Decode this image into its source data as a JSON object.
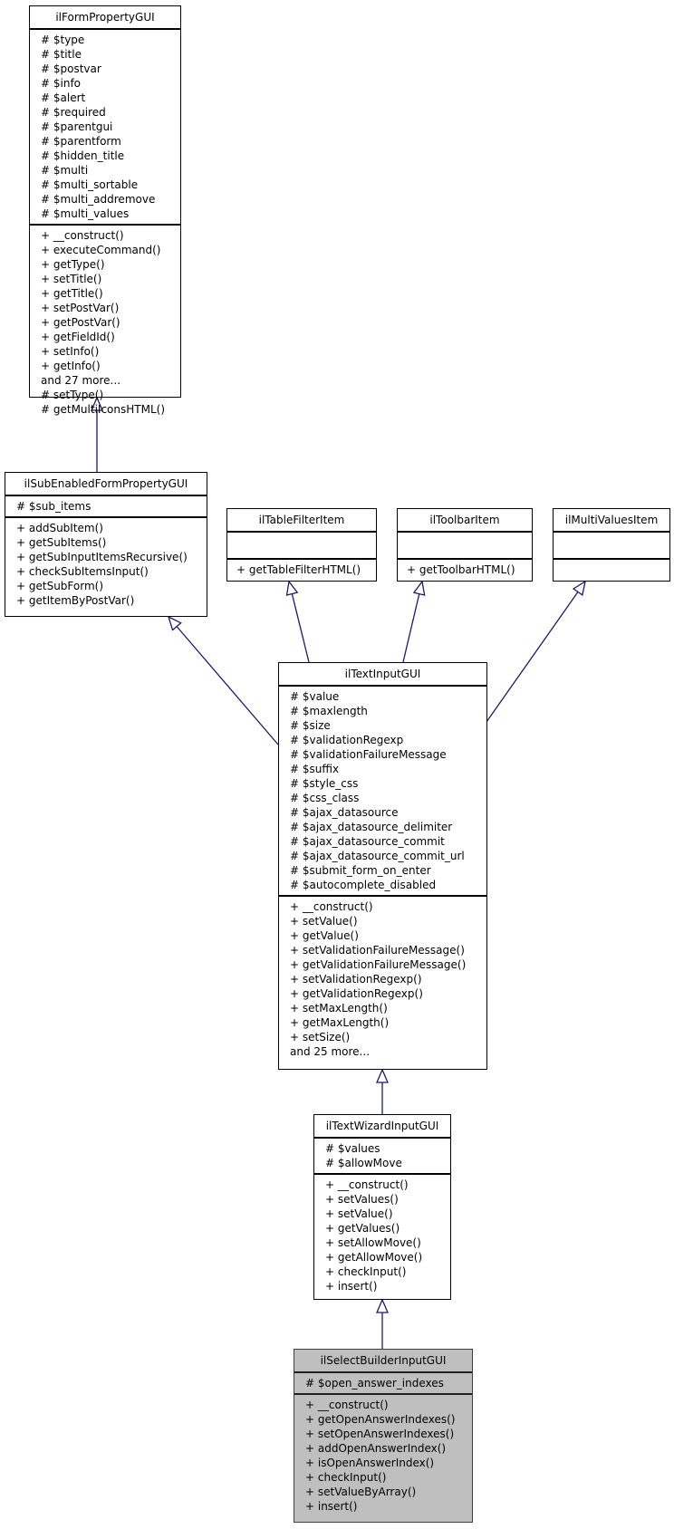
{
  "classes": {
    "ilFormPropertyGUI": {
      "name": "ilFormPropertyGUI",
      "attributes": [
        "# $type",
        "# $title",
        "# $postvar",
        "# $info",
        "# $alert",
        "# $required",
        "# $parentgui",
        "# $parentform",
        "# $hidden_title",
        "# $multi",
        "# $multi_sortable",
        "# $multi_addremove",
        "# $multi_values"
      ],
      "methods": [
        "+ __construct()",
        "+ executeCommand()",
        "+ getType()",
        "+ setTitle()",
        "+ getTitle()",
        "+ setPostVar()",
        "+ getPostVar()",
        "+ getFieldId()",
        "+ setInfo()",
        "+ getInfo()",
        "and 27 more...",
        "# setType()",
        "# getMultiIconsHTML()"
      ]
    },
    "ilSubEnabledFormPropertyGUI": {
      "name": "ilSubEnabledFormPropertyGUI",
      "attributes": [
        "# $sub_items"
      ],
      "methods": [
        "+ addSubItem()",
        "+ getSubItems()",
        "+ getSubInputItemsRecursive()",
        "+ checkSubItemsInput()",
        "+ getSubForm()",
        "+ getItemByPostVar()"
      ]
    },
    "ilTableFilterItem": {
      "name": "ilTableFilterItem",
      "attributes": [],
      "methods": [
        "+ getTableFilterHTML()"
      ]
    },
    "ilToolbarItem": {
      "name": "ilToolbarItem",
      "attributes": [],
      "methods": [
        "+ getToolbarHTML()"
      ]
    },
    "ilMultiValuesItem": {
      "name": "ilMultiValuesItem",
      "attributes": [],
      "methods": []
    },
    "ilTextInputGUI": {
      "name": "ilTextInputGUI",
      "attributes": [
        "# $value",
        "# $maxlength",
        "# $size",
        "# $validationRegexp",
        "# $validationFailureMessage",
        "# $suffix",
        "# $style_css",
        "# $css_class",
        "# $ajax_datasource",
        "# $ajax_datasource_delimiter",
        "# $ajax_datasource_commit",
        "# $ajax_datasource_commit_url",
        "# $submit_form_on_enter",
        "# $autocomplete_disabled"
      ],
      "methods": [
        "+ __construct()",
        "+ setValue()",
        "+ getValue()",
        "+ setValidationFailureMessage()",
        "+ getValidationFailureMessage()",
        "+ setValidationRegexp()",
        "+ getValidationRegexp()",
        "+ setMaxLength()",
        "+ getMaxLength()",
        "+ setSize()",
        "and 25 more..."
      ]
    },
    "ilTextWizardInputGUI": {
      "name": "ilTextWizardInputGUI",
      "attributes": [
        "# $values",
        "# $allowMove"
      ],
      "methods": [
        "+ __construct()",
        "+ setValues()",
        "+ setValue()",
        "+ getValues()",
        "+ setAllowMove()",
        "+ getAllowMove()",
        "+ checkInput()",
        "+ insert()"
      ]
    },
    "ilSelectBuilderInputGUI": {
      "name": "ilSelectBuilderInputGUI",
      "attributes": [
        "# $open_answer_indexes"
      ],
      "methods": [
        "+ __construct()",
        "+ getOpenAnswerIndexes()",
        "+ setOpenAnswerIndexes()",
        "+ addOpenAnswerIndex()",
        "+ isOpenAnswerIndex()",
        "+ checkInput()",
        "+ setValueByArray()",
        "+ insert()"
      ]
    }
  },
  "relations": [
    {
      "child": "ilSubEnabledFormPropertyGUI",
      "parent": "ilFormPropertyGUI",
      "type": "inheritance"
    },
    {
      "child": "ilTextInputGUI",
      "parent": "ilSubEnabledFormPropertyGUI",
      "type": "inheritance"
    },
    {
      "child": "ilTextInputGUI",
      "parent": "ilTableFilterItem",
      "type": "inheritance"
    },
    {
      "child": "ilTextInputGUI",
      "parent": "ilToolbarItem",
      "type": "inheritance"
    },
    {
      "child": "ilTextInputGUI",
      "parent": "ilMultiValuesItem",
      "type": "inheritance"
    },
    {
      "child": "ilTextWizardInputGUI",
      "parent": "ilTextInputGUI",
      "type": "inheritance"
    },
    {
      "child": "ilSelectBuilderInputGUI",
      "parent": "ilTextWizardInputGUI",
      "type": "inheritance"
    }
  ],
  "colors": {
    "edge": "#191970",
    "current_class_fill": "#bfbfbf"
  }
}
